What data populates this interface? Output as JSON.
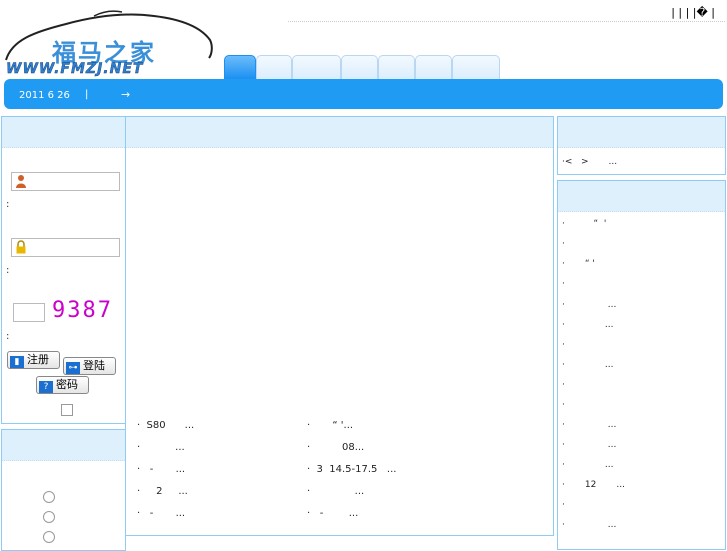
{
  "header": {
    "logo_cn": "福马之家",
    "logo_en": "WWW.FMZJ.NET",
    "top_links": "|    |    |    |� |"
  },
  "nav": {
    "tabs": [
      "",
      "",
      "",
      "",
      "",
      "",
      ""
    ],
    "date": "2011 6 26",
    "separator": "|",
    "arrow": "→"
  },
  "login": {
    "colon": ":",
    "captcha": "9387",
    "register_label": "注册",
    "login_label": "登陆",
    "password_label": "密码"
  },
  "news": {
    "left": [
      "·  S80      ...",
      "·           ...",
      "·   -       ...",
      "·     2     ...",
      "·   -       ..."
    ],
    "right": [
      "·       “ '...",
      "·          08...",
      "·  3  14.5-17.5   ...",
      "·              ...",
      "·   -        ..."
    ]
  },
  "right_top": {
    "item": "·<   >       ..."
  },
  "right_list": [
    "·          “  '",
    "·",
    "·       “ '",
    "·",
    "·               ...",
    "·              ...",
    "·",
    "·              ...",
    "·",
    "·",
    "·               ...",
    "·               ...",
    "·              ...",
    "·       12       ...",
    "·",
    "·               ..."
  ],
  "colors": {
    "nav": "#1f9bf4",
    "panel_border": "#8ecbf5",
    "panel_head": "#dff0fd",
    "captcha": "#cc00cc"
  }
}
